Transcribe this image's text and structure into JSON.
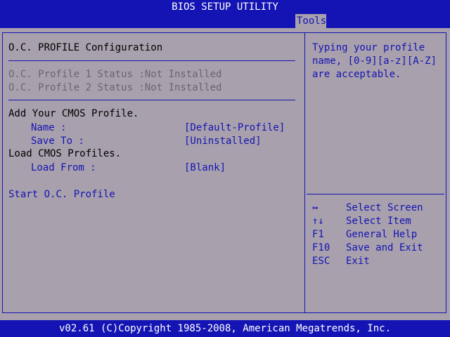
{
  "title": "BIOS SETUP UTILITY",
  "active_tab": "Tools",
  "section_title": "O.C. PROFILE Configuration",
  "status_lines": [
    "O.C. Profile 1 Status :Not Installed",
    "O.C. Profile 2 Status :Not Installed"
  ],
  "add_heading": "Add Your CMOS Profile.",
  "name_label": "Name :",
  "name_value": "[Default-Profile]",
  "save_label": "Save To :",
  "save_value": "[Uninstalled]",
  "load_heading": "Load CMOS Profiles.",
  "load_label": "Load From :",
  "load_value": "[Blank]",
  "start_label": "Start O.C. Profile",
  "help_text": [
    "Typing your profile",
    "name, [0-9][a-z][A-Z]",
    "are acceptable."
  ],
  "keys": [
    {
      "key": "↔",
      "desc": "Select Screen"
    },
    {
      "key": "↑↓",
      "desc": "Select Item"
    },
    {
      "key": "F1",
      "desc": "General Help"
    },
    {
      "key": "F10",
      "desc": "Save and Exit"
    },
    {
      "key": "ESC",
      "desc": "Exit"
    }
  ],
  "footer": "v02.61 (C)Copyright 1985-2008, American Megatrends, Inc.",
  "colors": {
    "background": "#a8a0ac",
    "accent": "#1414b4",
    "disabled": "#6c6470"
  }
}
